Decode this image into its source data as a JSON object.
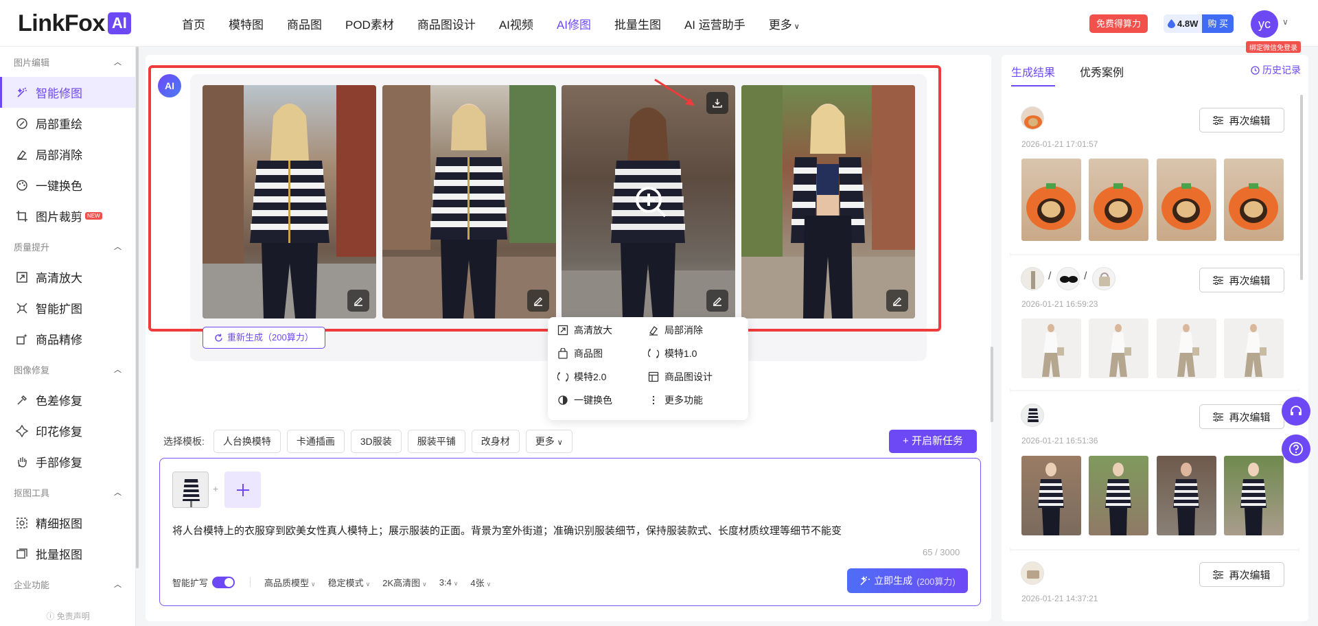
{
  "logo": {
    "text": "LinkFox",
    "badge": "AI"
  },
  "nav": [
    {
      "label": "首页"
    },
    {
      "label": "模特图"
    },
    {
      "label": "商品图"
    },
    {
      "label": "POD素材"
    },
    {
      "label": "商品图设计"
    },
    {
      "label": "AI视频"
    },
    {
      "label": "AI修图",
      "active": true
    },
    {
      "label": "批量生图"
    },
    {
      "label": "AI 运营助手"
    },
    {
      "label": "更多"
    }
  ],
  "header": {
    "free_label": "免费得算力",
    "points": "4.8W",
    "buy_label": "购 买",
    "avatar": "yc",
    "bind_tip": "绑定微信免登录"
  },
  "sidebar": {
    "sections": [
      {
        "title": "图片编辑",
        "items": [
          "智能修图",
          "局部重绘",
          "局部消除",
          "一键换色",
          "图片裁剪"
        ]
      },
      {
        "title": "质量提升",
        "items": [
          "高清放大",
          "智能扩图",
          "商品精修"
        ]
      },
      {
        "title": "图像修复",
        "items": [
          "色差修复",
          "印花修复",
          "手部修复"
        ]
      },
      {
        "title": "抠图工具",
        "items": [
          "精细抠图",
          "批量抠图"
        ]
      },
      {
        "title": "企业功能",
        "items": []
      }
    ],
    "new_badge": "NEW",
    "footer": "免责声明"
  },
  "result": {
    "ai_badge": "AI",
    "regen_label": "重新生成（200算力）"
  },
  "popup": {
    "items": [
      "高清放大",
      "局部消除",
      "商品图",
      "模特1.0",
      "模特2.0",
      "商品图设计",
      "一键换色",
      "更多功能"
    ]
  },
  "templates": {
    "label": "选择模板:",
    "items": [
      "人台换模特",
      "卡通插画",
      "3D服装",
      "服装平铺",
      "改身材",
      "更多"
    ],
    "new_task": "+ 开启新任务"
  },
  "prompt": {
    "text": "将人台模特上的衣服穿到欧美女性真人模特上；展示服装的正面。背景为室外街道；准确识别服装细节，保持服装款式、长度材质纹理等细节不能变",
    "count": "65 / 3000",
    "options": [
      "智能扩写",
      "高品质模型",
      "稳定模式",
      "2K高清图",
      "3:4",
      "4张"
    ],
    "generate_label": "立即生成",
    "generate_cost": "(200算力)"
  },
  "right": {
    "tabs": [
      "生成结果",
      "优秀案例"
    ],
    "history_label": "历史记录",
    "reedit_label": "再次编辑",
    "entries": [
      {
        "time": "2026-01-21 17:01:57"
      },
      {
        "time": "2026-01-21 16:59:23"
      },
      {
        "time": "2026-01-21 16:51:36"
      },
      {
        "time": "2026-01-21 14:37:21"
      }
    ]
  },
  "colors": {
    "accent": "#6d49f5",
    "danger": "#f2504b",
    "frame": "#ee3b3b"
  }
}
